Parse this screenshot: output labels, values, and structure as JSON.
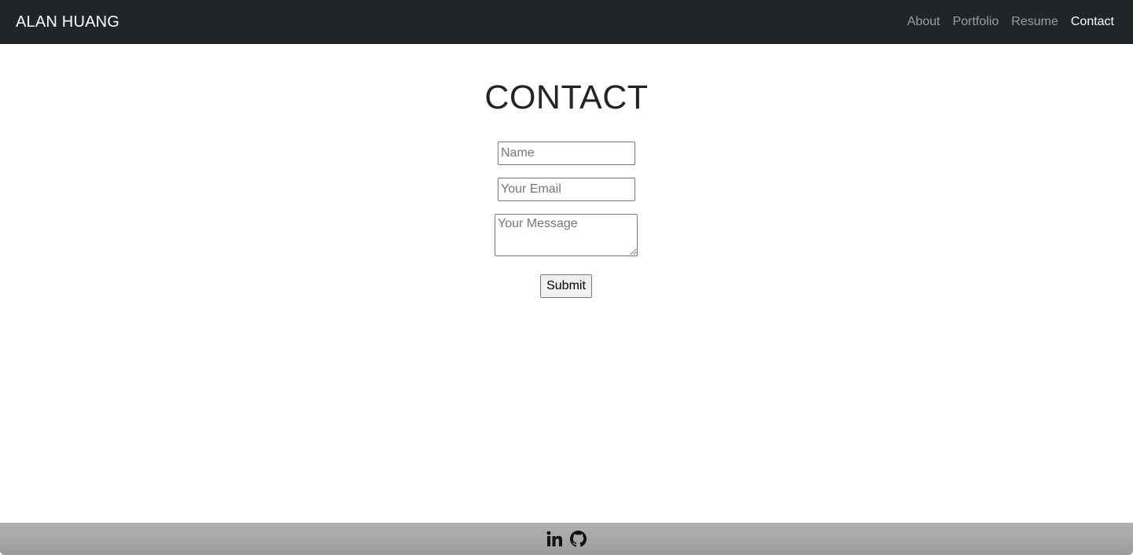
{
  "header": {
    "brand": "ALAN HUANG",
    "nav": [
      {
        "label": "About",
        "active": false
      },
      {
        "label": "Portfolio",
        "active": false
      },
      {
        "label": "Resume",
        "active": false
      },
      {
        "label": "Contact",
        "active": true
      }
    ]
  },
  "main": {
    "title": "CONTACT",
    "form": {
      "name_placeholder": "Name",
      "name_value": "",
      "email_placeholder": "Your Email",
      "email_value": "",
      "message_placeholder": "Your Message",
      "message_value": "",
      "submit_label": "Submit"
    }
  },
  "footer": {
    "links": [
      {
        "icon": "linkedin-icon"
      },
      {
        "icon": "github-icon"
      }
    ]
  },
  "colors": {
    "navbar": "#212529",
    "nav_inactive": "#8c8f92",
    "nav_active": "#ffffff",
    "footer": "#a7a7a9"
  }
}
